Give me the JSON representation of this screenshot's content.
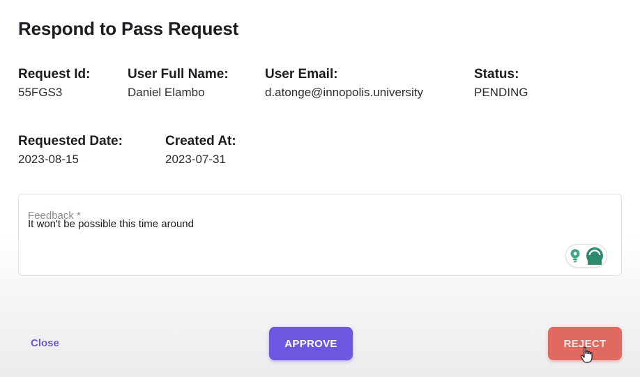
{
  "dialog": {
    "title": "Respond to Pass Request"
  },
  "details": {
    "request_id": {
      "label": "Request Id:",
      "value": "55FGS3"
    },
    "user_full_name": {
      "label": "User Full Name:",
      "value": "Daniel Elambo"
    },
    "user_email": {
      "label": "User Email:",
      "value": "d.atonge@innopolis.university"
    },
    "status": {
      "label": "Status:",
      "value": "PENDING"
    },
    "requested_date": {
      "label": "Requested Date:",
      "value": "2023-08-15"
    },
    "created_at": {
      "label": "Created At:",
      "value": "2023-07-31"
    }
  },
  "feedback": {
    "label": "Feedback *",
    "value": "It won't be possible this time around"
  },
  "actions": {
    "close_label": "Close",
    "approve_label": "APPROVE",
    "reject_label": "REJECT"
  },
  "colors": {
    "accent": "#6b57e0",
    "reject": "#e06a62",
    "extension": "#2e8a6e"
  },
  "icons": {
    "extension_left": "lightbulb-icon",
    "extension_right": "grammar-ring-icon",
    "pointer": "hand-pointer-icon"
  }
}
